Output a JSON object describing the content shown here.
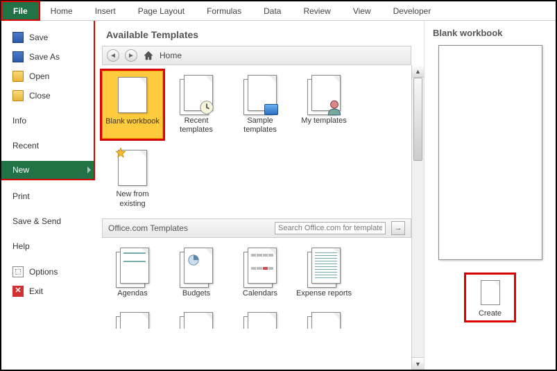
{
  "ribbon": {
    "tabs": [
      "File",
      "Home",
      "Insert",
      "Page Layout",
      "Formulas",
      "Data",
      "Review",
      "View",
      "Developer"
    ]
  },
  "sidebar": {
    "items": [
      {
        "label": "Save",
        "icon": "disk"
      },
      {
        "label": "Save As",
        "icon": "disk"
      },
      {
        "label": "Open",
        "icon": "folder"
      },
      {
        "label": "Close",
        "icon": "folder"
      }
    ],
    "items2": [
      {
        "label": "Info"
      },
      {
        "label": "Recent"
      },
      {
        "label": "New",
        "selected": true
      },
      {
        "label": "Print"
      },
      {
        "label": "Save & Send"
      },
      {
        "label": "Help"
      }
    ],
    "items3": [
      {
        "label": "Options",
        "icon": "opts"
      },
      {
        "label": "Exit",
        "icon": "x"
      }
    ]
  },
  "templates": {
    "title": "Available Templates",
    "breadcrumb": "Home",
    "row1": [
      {
        "label": "Blank workbook",
        "selected": true,
        "kind": "blank"
      },
      {
        "label": "Recent templates",
        "kind": "recent"
      },
      {
        "label": "Sample templates",
        "kind": "sample"
      },
      {
        "label": "My templates",
        "kind": "my"
      }
    ],
    "row1b": [
      {
        "label": "New from existing",
        "kind": "newfrom"
      }
    ],
    "office_header": "Office.com Templates",
    "search_placeholder": "Search Office.com for templates",
    "row2": [
      {
        "label": "Agendas"
      },
      {
        "label": "Budgets"
      },
      {
        "label": "Calendars"
      },
      {
        "label": "Expense reports"
      }
    ]
  },
  "preview": {
    "title": "Blank workbook",
    "create": "Create"
  }
}
